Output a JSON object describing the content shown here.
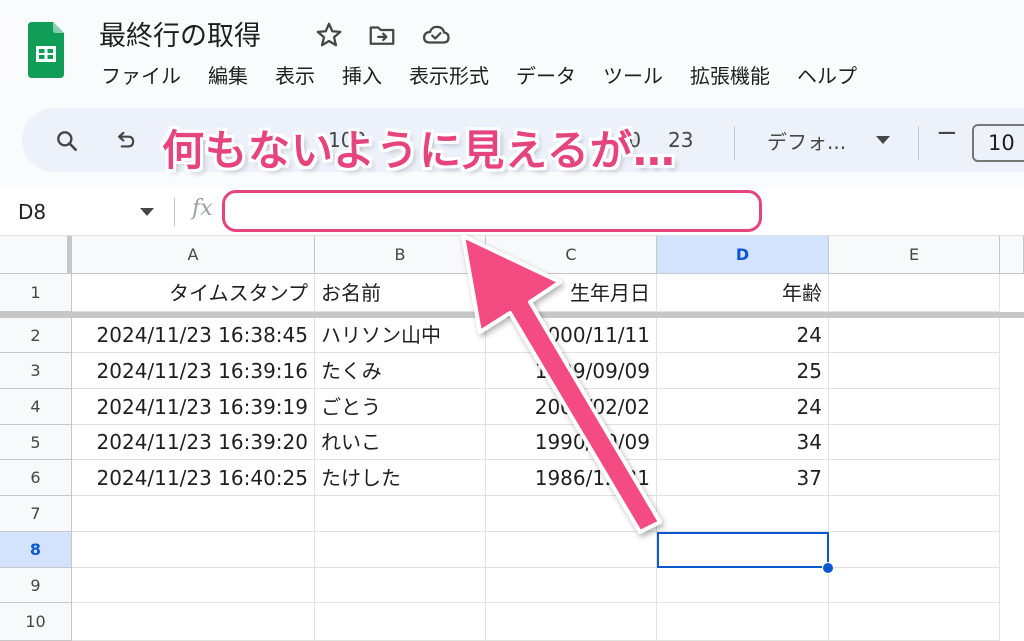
{
  "header": {
    "title": "最終行の取得",
    "menu": [
      "ファイル",
      "編集",
      "表示",
      "挿入",
      "表示形式",
      "データ",
      "ツール",
      "拡張機能",
      "ヘルプ"
    ]
  },
  "toolbar": {
    "zoom_partial": "100",
    "format_partial": ".0",
    "format_partial2": "23",
    "font_name": "デフォ...",
    "font_size": "10"
  },
  "formula_bar": {
    "cell_ref": "D8",
    "fx": "fx",
    "value": ""
  },
  "grid": {
    "columns": [
      "A",
      "B",
      "C",
      "D",
      "E"
    ],
    "selected_column": "D",
    "rows": [
      "1",
      "2",
      "3",
      "4",
      "5",
      "6",
      "7",
      "8",
      "9",
      "10"
    ],
    "selected_row": "8",
    "cells": [
      [
        "タイムスタンプ",
        "お名前",
        "生年月日",
        "年齢"
      ],
      [
        "2024/11/23 16:38:45",
        "ハリソン山中",
        "2000/11/11",
        "24"
      ],
      [
        "2024/11/23 16:39:16",
        "たくみ",
        "1999/09/09",
        "25"
      ],
      [
        "2024/11/23 16:39:19",
        "ごとう",
        "2000/02/02",
        "24"
      ],
      [
        "2024/11/23 16:39:20",
        "れいこ",
        "1990/09/09",
        "34"
      ],
      [
        "2024/11/23 16:40:25",
        "たけした",
        "1986/12/31",
        "37"
      ]
    ]
  },
  "annotation": {
    "text": "何もないように見えるが…",
    "color": "#e5457c"
  },
  "colors": {
    "selection": "#0b57d0",
    "header_selected_bg": "#d3e3fd",
    "sheets_green": "#0f9d58"
  }
}
